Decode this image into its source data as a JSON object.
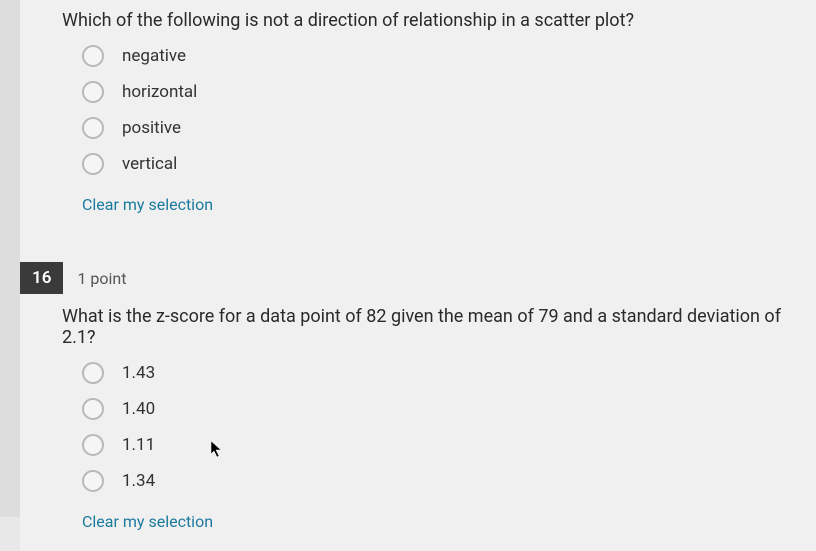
{
  "q1": {
    "text": "Which of the following is not a direction of relationship in a scatter plot?",
    "options": [
      "negative",
      "horizontal",
      "positive",
      "vertical"
    ],
    "clear": "Clear my selection"
  },
  "q2": {
    "number": "16",
    "points": "1 point",
    "text": "What is the z-score for a data point of 82 given the mean of 79 and a standard deviation of 2.1?",
    "options": [
      "1.43",
      "1.40",
      "1.11",
      "1.34"
    ],
    "clear": "Clear my selection"
  }
}
